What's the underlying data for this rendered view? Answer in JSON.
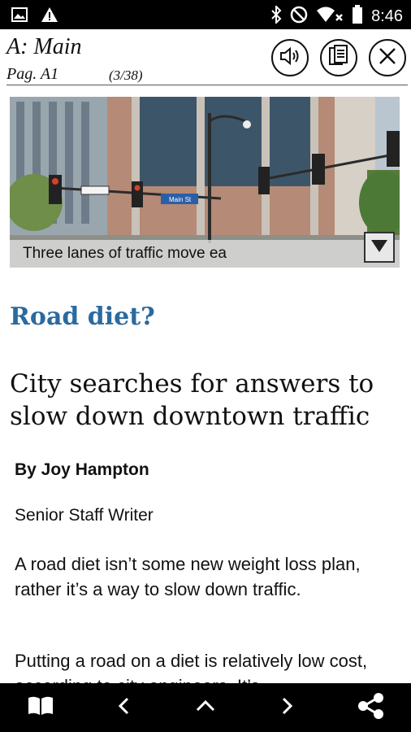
{
  "status_bar": {
    "time": "8:46",
    "icons": [
      "image-notification-icon",
      "warning-icon",
      "bluetooth-icon",
      "do-not-disturb-icon",
      "wifi-off-icon",
      "battery-icon"
    ]
  },
  "header": {
    "section": "A: Main",
    "page": "Pag. A1",
    "count": "(3/38)",
    "buttons": [
      "speaker-icon",
      "pages-icon",
      "close-icon"
    ]
  },
  "photo": {
    "caption": "Three lanes of traffic move ea",
    "sign_text": "Main St"
  },
  "article": {
    "kicker": "Road diet?",
    "headline": "City searches for answers to slow down downtown traffic",
    "byline": "By Joy Hampton",
    "role": "Senior Staff Writer",
    "para1": "A road diet isn’t some new weight loss plan, rather it’s a way to slow down traffic.",
    "para2": "Putting a road on a diet is relatively low cost, according to city engineers. It’s"
  },
  "bottom_nav": [
    "book-icon",
    "previous-icon",
    "up-icon",
    "next-icon",
    "share-icon"
  ],
  "colors": {
    "kicker": "#2a6aa0",
    "bars": "#000000"
  }
}
